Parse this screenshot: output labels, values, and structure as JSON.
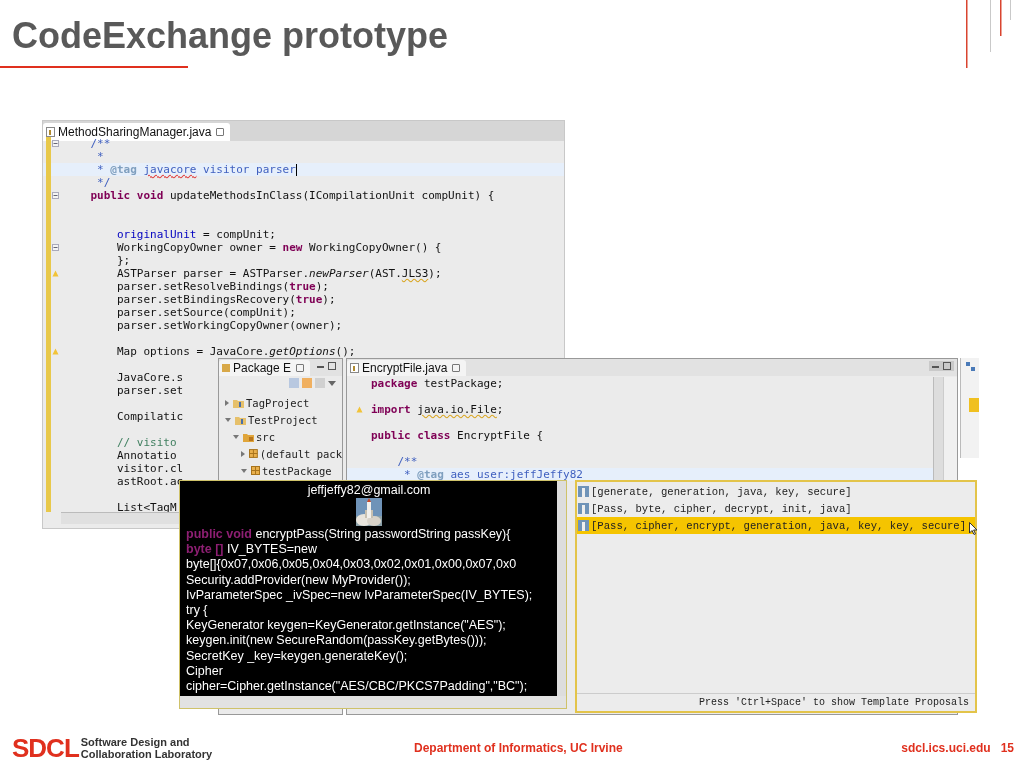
{
  "slide": {
    "title": "CodeExchange prototype"
  },
  "back_editor": {
    "tab": "MethodSharingManager.java",
    "lines": [
      {
        "kind": "code",
        "gutter": {
          "kind": "fold"
        },
        "segs": [
          {
            "text": "    /**",
            "kind": "comment"
          }
        ]
      },
      {
        "kind": "code",
        "segs": [
          {
            "text": "     *",
            "kind": "comment"
          }
        ]
      },
      {
        "kind": "current",
        "segs": [
          {
            "text": "     *",
            "kind": "comment"
          },
          {
            "text": " @tag ",
            "kind": "doctag"
          },
          {
            "text": "javacore",
            "kind": "spell"
          },
          {
            "text": " visitor parser",
            "kind": "comment"
          }
        ]
      },
      {
        "kind": "code",
        "segs": [
          {
            "text": "     */",
            "kind": "comment"
          }
        ]
      },
      {
        "kind": "code",
        "gutter": {
          "kind": "fold"
        },
        "segs": [
          {
            "text": "    public void",
            "kind": "keyword"
          },
          {
            "text": " updateMethodsInClass(ICompilationUnit compUnit) {",
            "kind": "plain"
          }
        ]
      },
      {
        "kind": "blank"
      },
      {
        "kind": "blank"
      },
      {
        "kind": "code",
        "segs": [
          {
            "text": "        originalUnit",
            "kind": "field"
          },
          {
            "text": " = compUnit;",
            "kind": "plain"
          }
        ]
      },
      {
        "kind": "code",
        "gutter": {
          "kind": "fold"
        },
        "segs": [
          {
            "text": "        WorkingCopyOwner owner = ",
            "kind": "plain"
          },
          {
            "text": "new",
            "kind": "keyword"
          },
          {
            "text": " WorkingCopyOwner() {",
            "kind": "plain"
          }
        ]
      },
      {
        "kind": "code",
        "segs": [
          {
            "text": "        };",
            "kind": "plain"
          }
        ]
      },
      {
        "kind": "code",
        "gutter": {
          "kind": "warning"
        },
        "segs": [
          {
            "text": "        ASTParser parser = ASTParser.",
            "kind": "plain"
          },
          {
            "text": "newParser",
            "kind": "italic"
          },
          {
            "text": "(AST.",
            "kind": "plain"
          },
          {
            "text": "JLS3",
            "kind": "warning"
          },
          {
            "text": ");",
            "kind": "plain"
          }
        ]
      },
      {
        "kind": "code",
        "segs": [
          {
            "text": "        parser.setResolveBindings(",
            "kind": "plain"
          },
          {
            "text": "true",
            "kind": "keyword"
          },
          {
            "text": ");",
            "kind": "plain"
          }
        ]
      },
      {
        "kind": "code",
        "segs": [
          {
            "text": "        parser.setBindingsRecovery(",
            "kind": "plain"
          },
          {
            "text": "true",
            "kind": "keyword"
          },
          {
            "text": ");",
            "kind": "plain"
          }
        ]
      },
      {
        "kind": "code",
        "segs": [
          {
            "text": "        parser.setSource(compUnit);",
            "kind": "plain"
          }
        ]
      },
      {
        "kind": "code",
        "segs": [
          {
            "text": "        parser.setWorkingCopyOwner(owner);",
            "kind": "plain"
          }
        ]
      },
      {
        "kind": "blank"
      },
      {
        "kind": "code",
        "gutter": {
          "kind": "warning"
        },
        "segs": [
          {
            "text": "        Map options = JavaCore.",
            "kind": "plain"
          },
          {
            "text": "getOptions",
            "kind": "italic"
          },
          {
            "text": "();",
            "kind": "plain"
          }
        ]
      },
      {
        "kind": "blank"
      },
      {
        "kind": "code",
        "segs": [
          {
            "text": "        JavaCore.s",
            "kind": "plain"
          }
        ]
      },
      {
        "kind": "code",
        "segs": [
          {
            "text": "        parser.set",
            "kind": "plain"
          }
        ]
      },
      {
        "kind": "blank"
      },
      {
        "kind": "code",
        "segs": [
          {
            "text": "        Compilatic",
            "kind": "plain"
          }
        ]
      },
      {
        "kind": "blank"
      },
      {
        "kind": "code",
        "segs": [
          {
            "text": "        // visito",
            "kind": "linecomment"
          }
        ]
      },
      {
        "kind": "code",
        "segs": [
          {
            "text": "        Annotatio",
            "kind": "plain"
          }
        ]
      },
      {
        "kind": "code",
        "segs": [
          {
            "text": "        visitor.cl",
            "kind": "plain"
          }
        ]
      },
      {
        "kind": "code",
        "segs": [
          {
            "text": "        astRoot.ac",
            "kind": "plain"
          }
        ]
      },
      {
        "kind": "blank"
      },
      {
        "kind": "code",
        "segs": [
          {
            "text": "        List<TagM",
            "kind": "plain"
          }
        ]
      }
    ]
  },
  "package_explorer": {
    "tab": "Package E",
    "tree": [
      {
        "label": "TagProject",
        "kind": "project",
        "expanded": false
      },
      {
        "label": "TestProject",
        "kind": "project",
        "expanded": true,
        "children": [
          {
            "label": "src",
            "kind": "source-folder",
            "expanded": true,
            "children": [
              {
                "label": "(default pack",
                "kind": "package",
                "expanded": false
              },
              {
                "label": "testPackage",
                "kind": "package",
                "expanded": true
              }
            ]
          }
        ]
      }
    ]
  },
  "front_editor": {
    "tab": "EncryptFile.java",
    "lines": [
      {
        "kind": "code",
        "segs": [
          {
            "text": "package",
            "kind": "keyword"
          },
          {
            "text": " testPackage;",
            "kind": "plain"
          }
        ]
      },
      {
        "kind": "blank"
      },
      {
        "kind": "code",
        "gutter": {
          "kind": "warning"
        },
        "segs": [
          {
            "text": "import ",
            "kind": "keyword"
          },
          {
            "text": "java.io.File",
            "kind": "warning"
          },
          {
            "text": ";",
            "kind": "plain"
          }
        ]
      },
      {
        "kind": "blank"
      },
      {
        "kind": "code",
        "segs": [
          {
            "text": "public class",
            "kind": "keyword"
          },
          {
            "text": " EncryptFile {",
            "kind": "plain"
          }
        ]
      },
      {
        "kind": "blank"
      },
      {
        "kind": "code",
        "segs": [
          {
            "text": "    /**",
            "kind": "comment"
          }
        ]
      },
      {
        "kind": "current",
        "segs": [
          {
            "text": "     *",
            "kind": "comment"
          },
          {
            "text": " @tag ",
            "kind": "doctag"
          },
          {
            "text": "aes",
            "kind": "spell"
          },
          {
            "text": " user:jeffJeffy82",
            "kind": "comment"
          }
        ]
      }
    ]
  },
  "snippet_popup": {
    "author": "jeffjeffy82@gmail.com",
    "lines": [
      {
        "segs": [
          {
            "text": "public void",
            "kind": "keyword"
          },
          {
            "text": " encryptPass(String passwordString passKey){",
            "kind": "plain"
          }
        ]
      },
      {
        "segs": [
          {
            "text": "byte []",
            "kind": "keyword"
          },
          {
            "text": " IV_BYTES=new",
            "kind": "plain"
          }
        ]
      },
      {
        "segs": [
          {
            "text": "byte[]{0x07,0x06,0x05,0x04,0x03,0x02,0x01,0x00,0x07,0x0",
            "kind": "plain"
          }
        ]
      },
      {
        "segs": [
          {
            "text": "Security.addProvider(new MyProvider());",
            "kind": "plain"
          }
        ]
      },
      {
        "segs": [
          {
            "text": "IvParameterSpec _ivSpec=new IvParameterSpec(IV_BYTES);",
            "kind": "plain"
          }
        ]
      },
      {
        "segs": [
          {
            "text": "try {",
            "kind": "plain"
          }
        ]
      },
      {
        "segs": [
          {
            "text": "KeyGenerator keygen=KeyGenerator.getInstance(\"AES\");",
            "kind": "plain"
          }
        ]
      },
      {
        "segs": [
          {
            "text": "keygen.init(new SecureRandom(passKey.getBytes()));",
            "kind": "plain"
          }
        ]
      },
      {
        "segs": [
          {
            "text": "SecretKey _key=keygen.generateKey();",
            "kind": "plain"
          }
        ]
      },
      {
        "segs": [
          {
            "text": "Cipher",
            "kind": "plain"
          }
        ]
      },
      {
        "segs": [
          {
            "text": "cipher=Cipher.getInstance(\"AES/CBC/PKCS7Padding\",\"BC\");",
            "kind": "plain"
          }
        ]
      }
    ]
  },
  "proposals": {
    "items": [
      {
        "text": "[generate, generation, java, key, secure]",
        "selected": false
      },
      {
        "text": "[Pass, byte, cipher, decrypt, init, java]",
        "selected": false
      },
      {
        "text": "[Pass, cipher, encrypt, generation, java, key, key, secure]",
        "selected": true
      }
    ],
    "hint": "Press 'Ctrl+Space' to show Template Proposals"
  },
  "footer": {
    "logo": "SDCL",
    "lab_line_1": "Software Design and",
    "lab_line_2": "Collaboration Laboratory",
    "department": "Department of Informatics, UC Irvine",
    "url": "sdcl.ics.uci.edu",
    "page": "15"
  }
}
